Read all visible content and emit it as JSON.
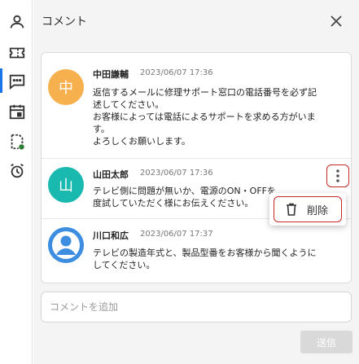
{
  "panel": {
    "title": "コメント"
  },
  "sidebar": {
    "items": [
      {
        "icon": "person-icon",
        "active": false
      },
      {
        "icon": "ticket-icon",
        "active": false
      },
      {
        "icon": "comment-icon",
        "active": true
      },
      {
        "icon": "calendar-icon",
        "active": false
      },
      {
        "icon": "task-status-icon",
        "active": false
      },
      {
        "icon": "alarm-icon",
        "active": false
      }
    ],
    "accent_color": "#1a73e8",
    "status_dot_color": "#2e7d32"
  },
  "comments": [
    {
      "avatar_char": "中",
      "avatar_color": "#f6b04e",
      "author": "中田謙輔",
      "time": "2023/06/07 17:36",
      "lines": [
        "返信するメールに修理サポート窓口の電話番号を必ず記",
        "述してください。",
        "お客様によっては電話によるサポートを求める方がいま",
        "す。",
        "よろしくお願いします。"
      ]
    },
    {
      "avatar_char": "山",
      "avatar_color": "#19b9b0",
      "author": "山田太郎",
      "time": "2023/06/07 17:36",
      "lines": [
        "テレビ側に問題が無いか、電源のON・OFFを",
        "度試していただく様にお伝えください。"
      ]
    },
    {
      "avatar_char": "",
      "avatar_color": "#3d8ee0",
      "author": "川口和広",
      "time": "2023/06/07 17:37",
      "lines": [
        "テレビの製造年式と、製品型番をお客様から聞くように",
        "してください。"
      ]
    }
  ],
  "menu": {
    "delete_label": "削除"
  },
  "compose": {
    "placeholder": "コメントを追加",
    "value": "",
    "send_label": "送信"
  },
  "colors": {
    "highlight_border": "#c62828",
    "send_disabled_bg": "#d9d9d9"
  }
}
